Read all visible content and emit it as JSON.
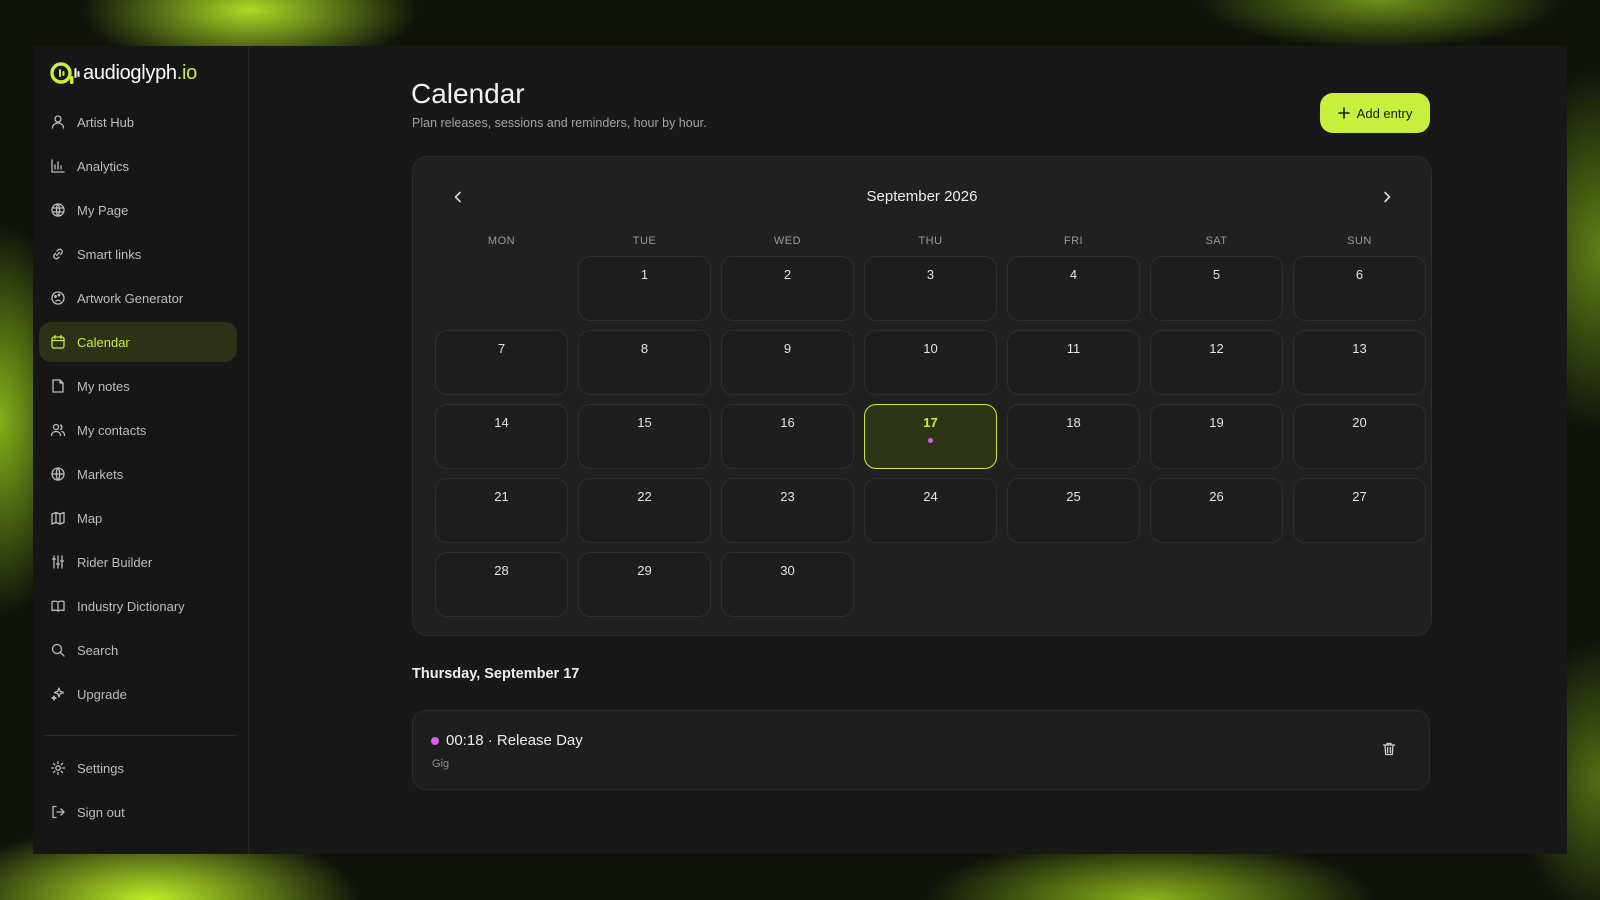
{
  "brand": {
    "name": "audioglyph",
    "tld": ".io",
    "accent": "#c8ef3e"
  },
  "sidebar": {
    "items": [
      {
        "label": "Artist Hub",
        "icon": "user-icon"
      },
      {
        "label": "Analytics",
        "icon": "bar-chart-icon"
      },
      {
        "label": "My Page",
        "icon": "globe-grid-icon"
      },
      {
        "label": "Smart links",
        "icon": "link-icon"
      },
      {
        "label": "Artwork Generator",
        "icon": "palette-icon"
      },
      {
        "label": "Calendar",
        "icon": "calendar-icon",
        "active": true
      },
      {
        "label": "My notes",
        "icon": "note-icon"
      },
      {
        "label": "My contacts",
        "icon": "contacts-icon"
      },
      {
        "label": "Markets",
        "icon": "globe-icon"
      },
      {
        "label": "Map",
        "icon": "map-icon"
      },
      {
        "label": "Rider Builder",
        "icon": "sliders-icon"
      },
      {
        "label": "Industry Dictionary",
        "icon": "book-icon"
      },
      {
        "label": "Search",
        "icon": "search-icon"
      },
      {
        "label": "Upgrade",
        "icon": "sparkles-icon"
      }
    ],
    "bottom": [
      {
        "label": "Settings",
        "icon": "gear-icon"
      },
      {
        "label": "Sign out",
        "icon": "sign-out-icon"
      }
    ]
  },
  "header": {
    "title": "Calendar",
    "subtitle": "Plan releases, sessions and reminders, hour by hour.",
    "add_label": "Add entry"
  },
  "calendar": {
    "month_label": "September 2026",
    "weekdays": [
      "MON",
      "TUE",
      "WED",
      "THU",
      "FRI",
      "SAT",
      "SUN"
    ],
    "leading_blank_days": 1,
    "days_in_month": 30,
    "selected_day": 17,
    "days_with_events": [
      17
    ]
  },
  "selected_date_heading": "Thursday, September 17",
  "events": [
    {
      "title": "00:18 · Release Day",
      "type": "Gig",
      "color": "#d65ce8"
    }
  ]
}
